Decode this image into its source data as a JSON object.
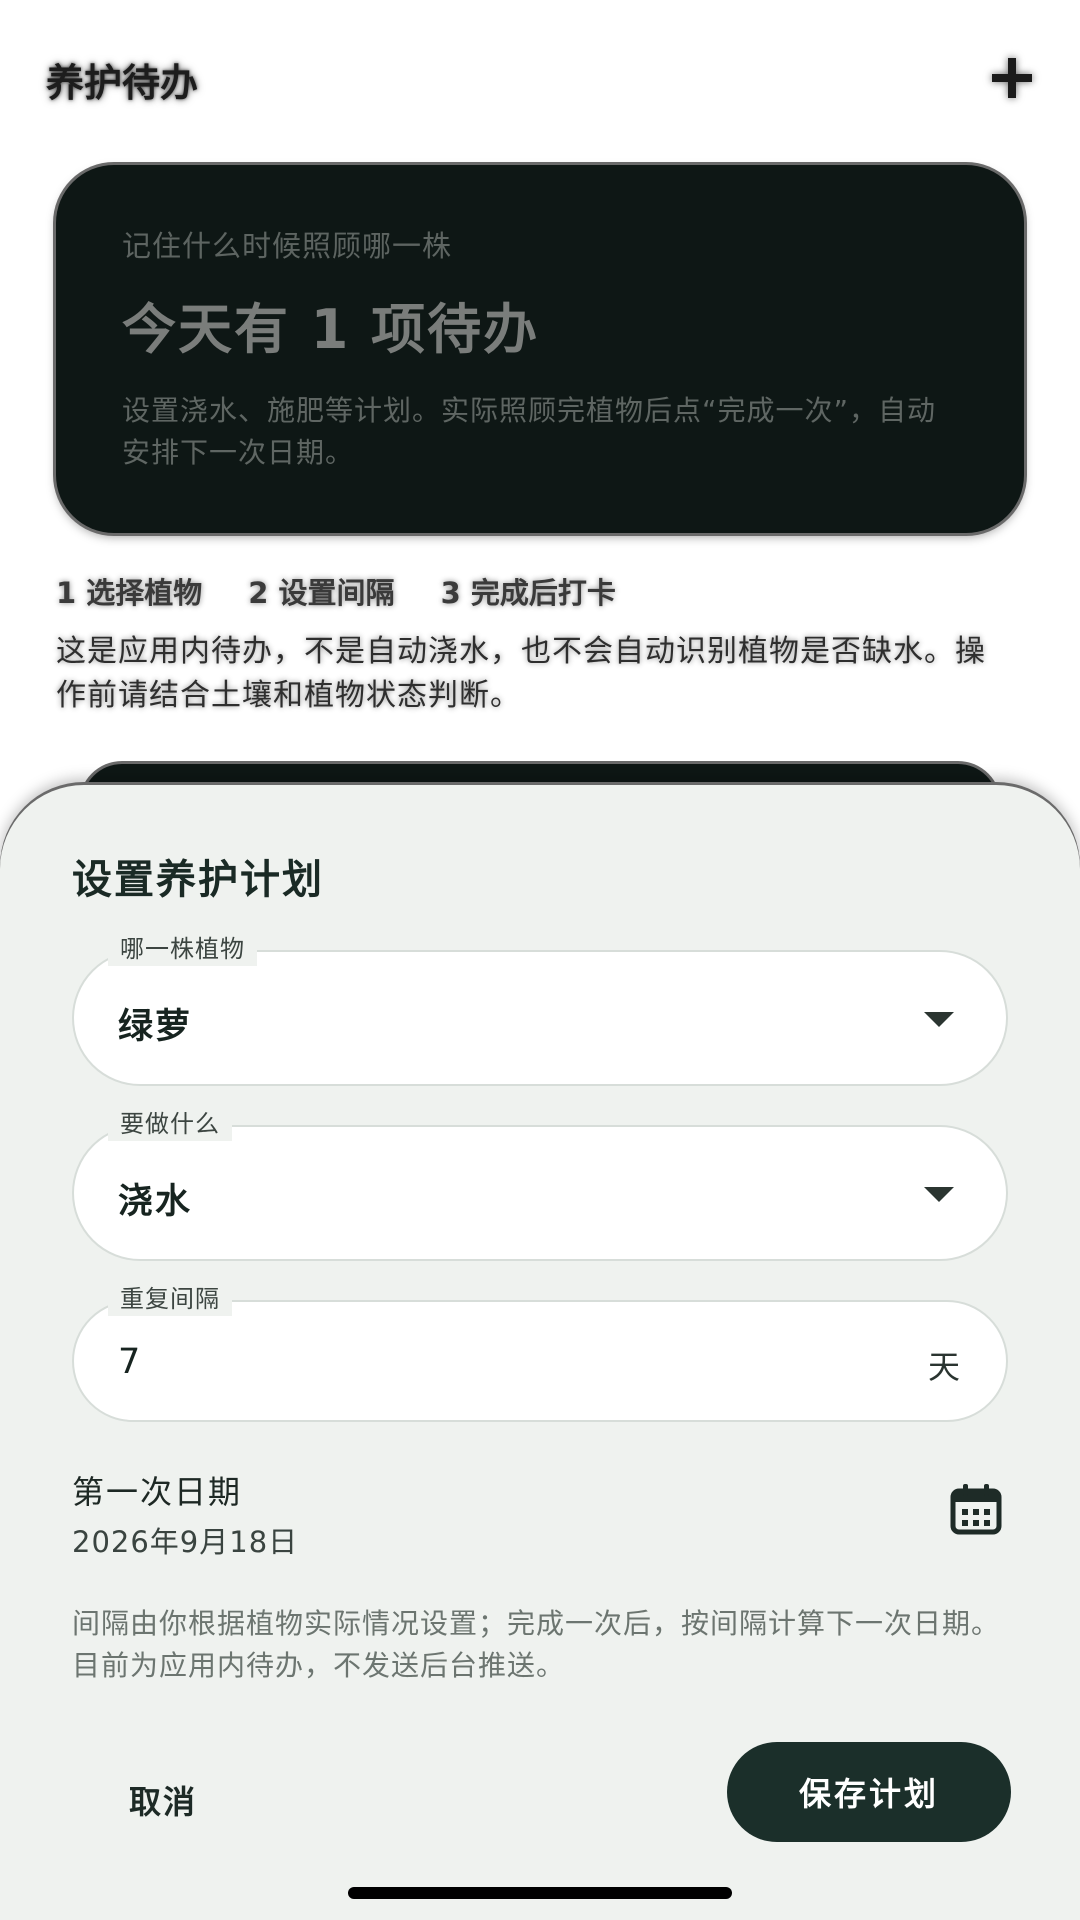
{
  "appbar": {
    "title": "养护待办",
    "add_icon": "plus-icon"
  },
  "hero": {
    "kicker": "记住什么时候照顾哪一株",
    "title": "今天有 1 项待办",
    "description": "设置浇水、施肥等计划。实际照顾完植物后点“完成一次”，自动安排下一次日期。"
  },
  "steps": [
    "1 选择植物",
    "2 设置间隔",
    "3 完成后打卡"
  ],
  "notice": "这是应用内待办，不是自动浇水，也不会自动识别植物是否缺水。操作前请结合土壤和植物状态判断。",
  "sheet": {
    "title": "设置养护计划",
    "plant_field": {
      "label": "哪一株植物",
      "value": "绿萝",
      "icon": "chevron-down-icon"
    },
    "task_field": {
      "label": "要做什么",
      "value": "浇水",
      "icon": "chevron-down-icon"
    },
    "interval_field": {
      "label": "重复间隔",
      "value": "7",
      "suffix": "天"
    },
    "first_date": {
      "label": "第一次日期",
      "value": "2026年9月18日",
      "icon": "calendar-icon"
    },
    "hint": "间隔由你根据植物实际情况设置；完成一次后，按间隔计算下一次日期。目前为应用内待办，不发送后台推送。",
    "cancel_label": "取消",
    "save_label": "保存计划"
  },
  "colors": {
    "hero_bg": "#0e1715",
    "sheet_bg": "#eff2ef",
    "primary_button": "#1b2f2a",
    "text_dark": "#172420"
  }
}
